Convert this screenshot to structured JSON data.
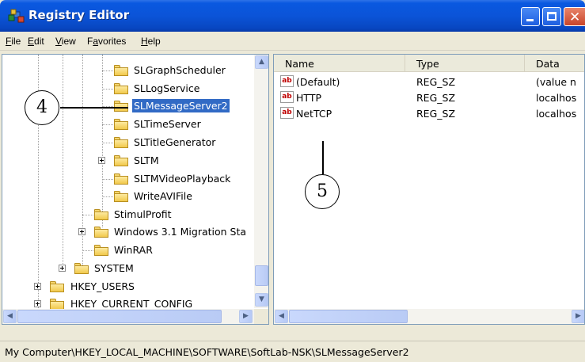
{
  "window": {
    "title": "Registry Editor"
  },
  "menu": [
    {
      "label": "File",
      "underline": "F",
      "rest": "ile"
    },
    {
      "label": "Edit",
      "underline": "E",
      "rest": "dit"
    },
    {
      "label": "View",
      "underline": "V",
      "rest": "iew"
    },
    {
      "label": "Favorites",
      "prefix": "F",
      "underline": "a",
      "rest": "vorites"
    },
    {
      "label": "Help",
      "underline": "H",
      "rest": "elp"
    }
  ],
  "tree": {
    "items": [
      {
        "label": "SLGraphScheduler"
      },
      {
        "label": "SLLogService"
      },
      {
        "label": "SLMessageServer2",
        "selected": true
      },
      {
        "label": "SLTimeServer"
      },
      {
        "label": "SLTitleGenerator"
      },
      {
        "label": "SLTM",
        "expandable": true
      },
      {
        "label": "SLTMVideoPlayback"
      },
      {
        "label": "WriteAVIFile"
      },
      {
        "label": "StimulProfit"
      },
      {
        "label": "Windows 3.1 Migration Sta",
        "expandable": true
      },
      {
        "label": "WinRAR"
      },
      {
        "label": "SYSTEM",
        "expandable": true
      },
      {
        "label": "HKEY_USERS",
        "expandable": true
      },
      {
        "label": "HKEY_CURRENT_CONFIG",
        "expandable": true
      }
    ]
  },
  "list": {
    "columns": [
      "Name",
      "Type",
      "Data"
    ],
    "rows": [
      {
        "name": "(Default)",
        "type": "REG_SZ",
        "data": "(value n"
      },
      {
        "name": "HTTP",
        "type": "REG_SZ",
        "data": "localhos"
      },
      {
        "name": "NetTCP",
        "type": "REG_SZ",
        "data": "localhos"
      }
    ],
    "icon_text": "ab"
  },
  "callouts": {
    "tree": "4",
    "list": "5"
  },
  "status": {
    "path": "My Computer\\HKEY_LOCAL_MACHINE\\SOFTWARE\\SoftLab-NSK\\SLMessageServer2"
  },
  "colors": {
    "titlebar": "#0a58e0",
    "selection": "#316ac5",
    "close_button": "#c8452a"
  }
}
